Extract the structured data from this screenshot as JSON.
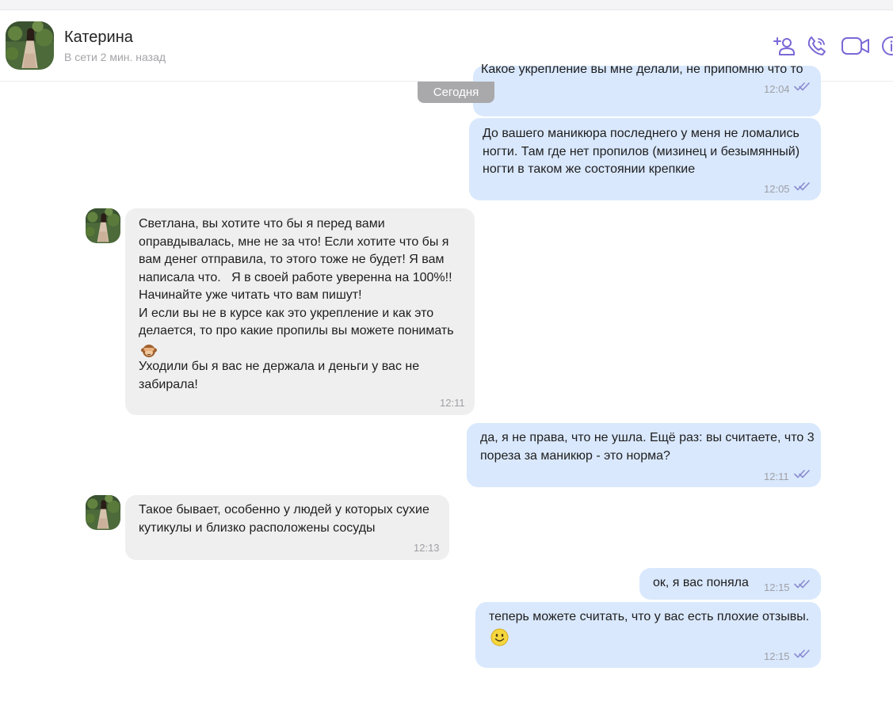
{
  "header": {
    "name": "Катерина",
    "status": "В сети 2 мин. назад"
  },
  "icons": {
    "add_contact": "add-user-icon",
    "call": "phone-icon",
    "video": "video-icon",
    "info": "info-icon"
  },
  "colors": {
    "accent": "#7b68d6",
    "outgoing_bubble": "#d9e8fd",
    "incoming_bubble": "#efefef",
    "date_pill": "#a9a9ab"
  },
  "chat": {
    "date_label": "Сегодня",
    "messages": [
      {
        "dir": "out",
        "text": "Какое укрепление вы мне делали, не припомню что то",
        "time": "12:04",
        "read": true
      },
      {
        "dir": "out",
        "text": "До вашего маникюра последнего у меня не ломались\nногти. Там где нет пропилов (мизинец и безымянный)\nногти в таком же состоянии крепкие",
        "time": "12:05",
        "read": true
      },
      {
        "dir": "in",
        "text_before_emoji": "Светлана, вы хотите что бы я перед вами\nоправдывалась, мне не за что! Если хотите что бы я\nвам денег отправила, то этого тоже не будет! Я вам\nнаписала что.   Я в своей работе уверенна на 100%!!\nНачинайте уже читать что вам пишут!\nИ если вы не в курсе как это укрепление и как это\nделается, то про какие пропилы вы можете понимать",
        "emoji": "see-no-evil-monkey-emoji",
        "text_after_emoji": "Уходили бы я вас не держала и деньги у вас не\nзабирала!",
        "time": "12:11"
      },
      {
        "dir": "out",
        "text": "да, я не права, что не ушла. Ещё раз: вы считаете, что 3\nпореза за маникюр - это норма?",
        "time": "12:11",
        "read": true
      },
      {
        "dir": "in",
        "text": "Такое бывает, особенно у людей у которых сухие\nкутикулы и близко расположены сосуды",
        "time": "12:13"
      },
      {
        "dir": "out",
        "text": "ок, я вас поняла",
        "time": "12:15",
        "read": true
      },
      {
        "dir": "out",
        "text": "теперь можете считать, что у вас есть плохие отзывы.",
        "emoji": "smiling-face-emoji",
        "time": "12:15",
        "read": true
      }
    ]
  }
}
